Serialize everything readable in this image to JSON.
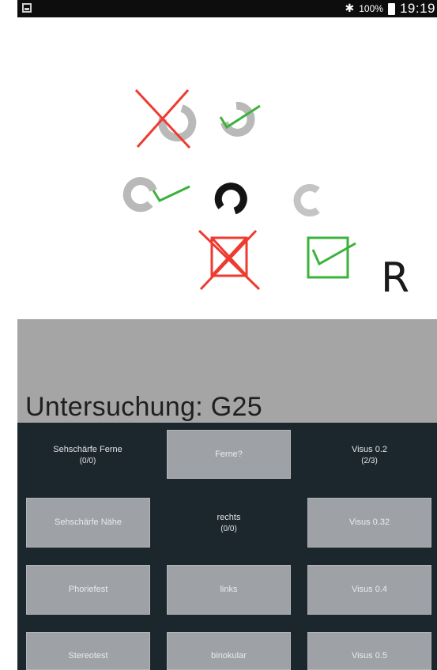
{
  "status_bar": {
    "battery": "100%",
    "time": "19:19"
  },
  "test": {
    "eye": "R",
    "colors": {
      "wrong": "#ee3b30",
      "correct": "#3bb23b",
      "ring_faded": "#b9b9b9",
      "ring_active": "#141414"
    }
  },
  "header": {
    "title": "Untersuchung: G25"
  },
  "menu": {
    "col1": {
      "title": "Sehschärfe Ferne",
      "count": "(0/0)",
      "buttons": [
        "Sehschärfe Nähe",
        "Phoriefest",
        "Stereotest"
      ]
    },
    "col2": {
      "button_top": "Ferne?",
      "title": "rechts",
      "count": "(0/0)",
      "buttons": [
        "links",
        "binokular"
      ]
    },
    "col3": {
      "title": "Visus 0.2",
      "count": "(2/3)",
      "buttons": [
        "Visus 0.32",
        "Visus 0.4",
        "Visus 0.5"
      ]
    }
  }
}
